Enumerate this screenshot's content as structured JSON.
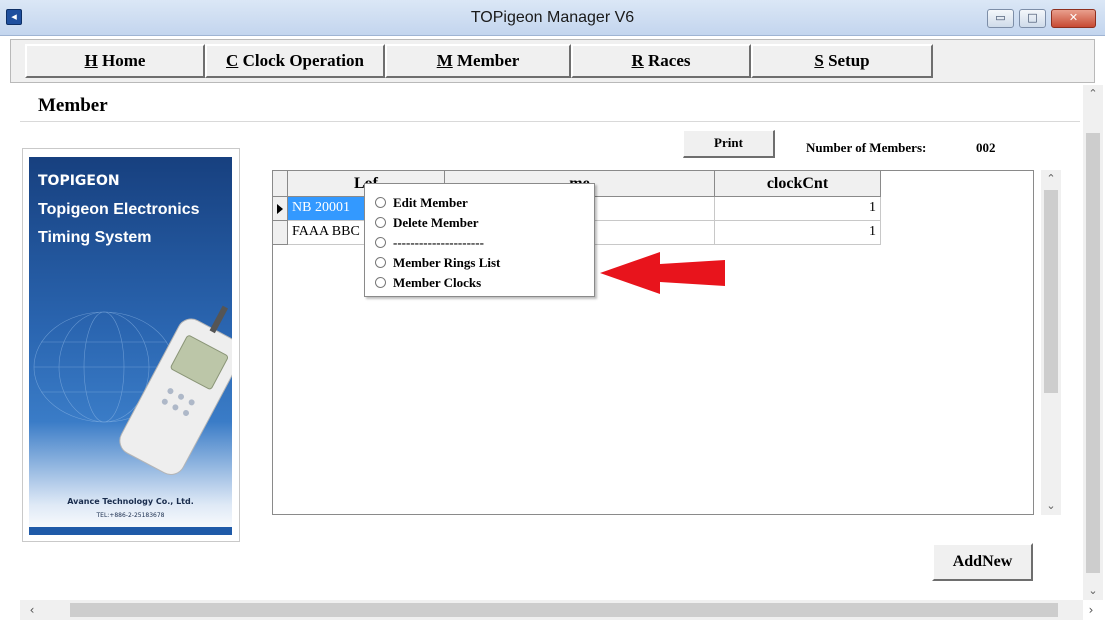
{
  "window": {
    "title": "TOPigeon Manager V6",
    "min_glyph": "▭",
    "max_glyph": "□",
    "close_glyph": "✕"
  },
  "menu": [
    {
      "key": "H",
      "label": " Home"
    },
    {
      "key": "C",
      "label": " Clock Operation"
    },
    {
      "key": "M",
      "label": " Member"
    },
    {
      "key": "R",
      "label": " Races"
    },
    {
      "key": "S",
      "label": " Setup"
    }
  ],
  "page": {
    "title": "Member",
    "print_label": "Print",
    "members_label": "Number of Members:",
    "members_count": "002",
    "addnew_label": "AddNew"
  },
  "banner": {
    "logo": "TOPIGEON",
    "line1": "Topigeon Electronics",
    "line2": "Timing System",
    "company": "Avance Technology Co., Ltd.",
    "tel": "TEL:+886-2-25183678"
  },
  "grid": {
    "columns": [
      "Lof",
      "me",
      "clockCnt"
    ],
    "rows": [
      {
        "loft": "NB 20001",
        "name": "",
        "clockcnt": "1"
      },
      {
        "loft": "FAAA BBC",
        "name": "",
        "clockcnt": "1"
      }
    ]
  },
  "context_menu": [
    "Edit Member",
    "Delete Member",
    "---------------------",
    "Member Rings List",
    "Member Clocks"
  ],
  "colors": {
    "selection": "#3399ff",
    "arrow": "#e8141c",
    "banner": "#2a65b0"
  }
}
